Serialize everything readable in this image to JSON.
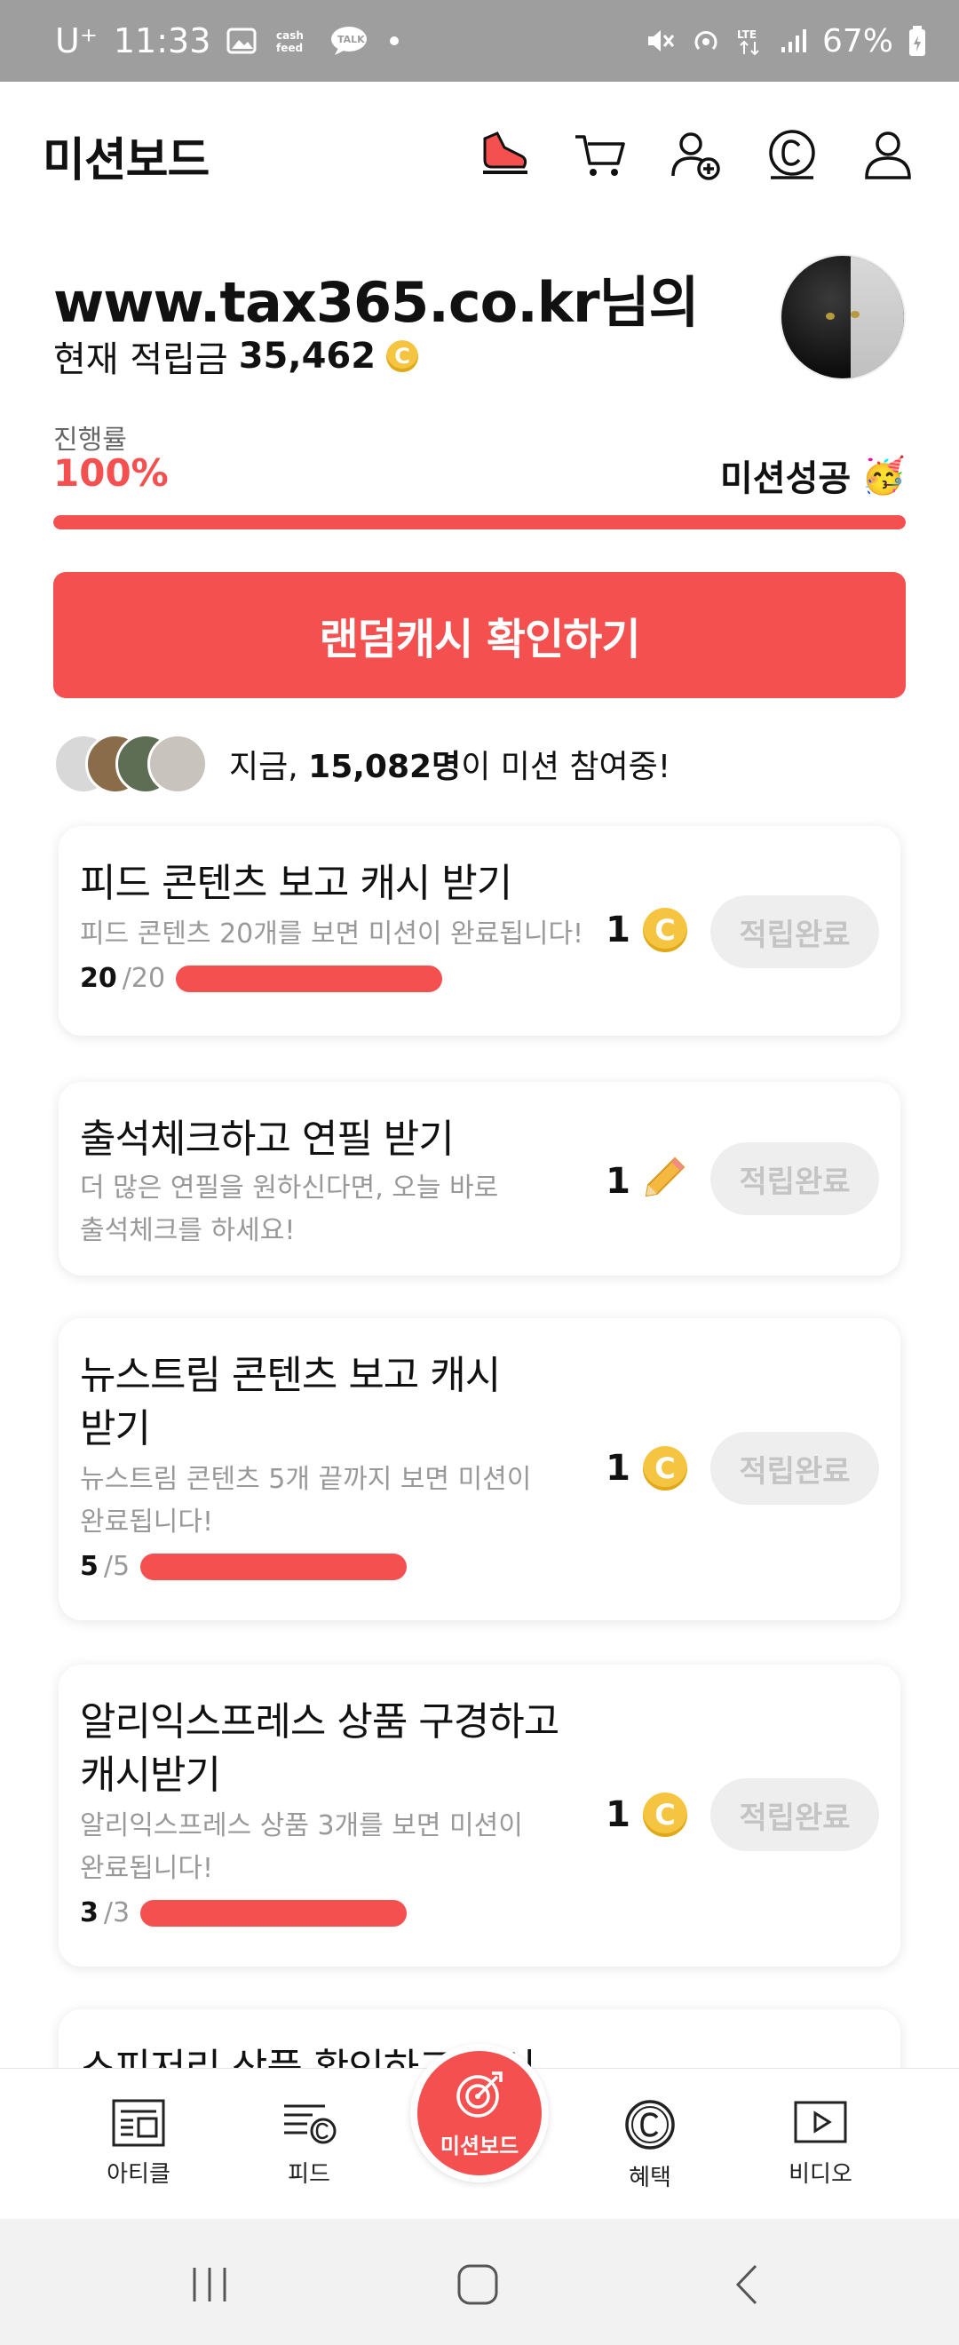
{
  "status_bar": {
    "carrier": "U⁺",
    "time": "11:33",
    "battery": "67%"
  },
  "header": {
    "title": "미션보드",
    "icons": [
      "shoe-icon",
      "cart-icon",
      "add-friend-icon",
      "cash-coin-icon",
      "profile-icon"
    ]
  },
  "profile": {
    "name": "www.tax365.co.kr님의",
    "balance_label": "현재 적립금",
    "balance_value": "35,462"
  },
  "progress": {
    "label": "진행률",
    "value_text": "100%",
    "fraction": 1.0,
    "status": "미션성공",
    "status_emoji": "🥳"
  },
  "random_cash_button": "랜덤캐시 확인하기",
  "participants": {
    "prefix": "지금, ",
    "count": "15,082명",
    "suffix": "이 미션 참여중!"
  },
  "missions": [
    {
      "title_line1": "피드 콘텐츠 보고 캐시 받기",
      "title_line2": "",
      "desc_line1": "피드 콘텐츠 20개를 보면 미션이 완료됩니다!",
      "desc_line2": "",
      "progress_current": "20",
      "progress_total": "/20",
      "progress_fraction": 1.0,
      "reward": "1",
      "reward_type": "coin",
      "button": "적립완료"
    },
    {
      "title_line1": "출석체크하고 연필 받기",
      "title_line2": "",
      "desc_line1": "더 많은 연필을 원하신다면, 오늘 바로",
      "desc_line2": "출석체크를 하세요!",
      "reward": "1",
      "reward_type": "pencil",
      "button": "적립완료"
    },
    {
      "title_line1": "뉴스트림 콘텐츠 보고 캐시",
      "title_line2": "받기",
      "desc_line1": "뉴스트림 콘텐츠 5개 끝까지 보면 미션이",
      "desc_line2": "완료됩니다!",
      "progress_current": "5",
      "progress_total": "/5",
      "progress_fraction": 1.0,
      "reward": "1",
      "reward_type": "coin",
      "button": "적립완료"
    },
    {
      "title_line1": "알리익스프레스 상품 구경하고",
      "title_line2": "캐시받기",
      "desc_line1": "알리익스프레스 상품 3개를 보면 미션이",
      "desc_line2": "완료됩니다!",
      "progress_current": "3",
      "progress_total": "/3",
      "progress_fraction": 1.0,
      "reward": "1",
      "reward_type": "coin",
      "button": "적립완료"
    }
  ],
  "partial_card_title": "스피저리 상품 확인하고 캐시",
  "bottom_nav": {
    "items": [
      {
        "label": "아티클",
        "icon": "article-icon"
      },
      {
        "label": "피드",
        "icon": "feed-icon"
      },
      {
        "label": "미션보드",
        "icon": "target-icon"
      },
      {
        "label": "혜택",
        "icon": "benefit-coin-icon"
      },
      {
        "label": "비디오",
        "icon": "video-play-icon"
      }
    ]
  },
  "colors": {
    "accent": "#f45050",
    "coin": "#f5c542",
    "done_bg": "#eeeeee",
    "done_text": "#c4c4c4",
    "status_bar": "#9e9e9e"
  }
}
